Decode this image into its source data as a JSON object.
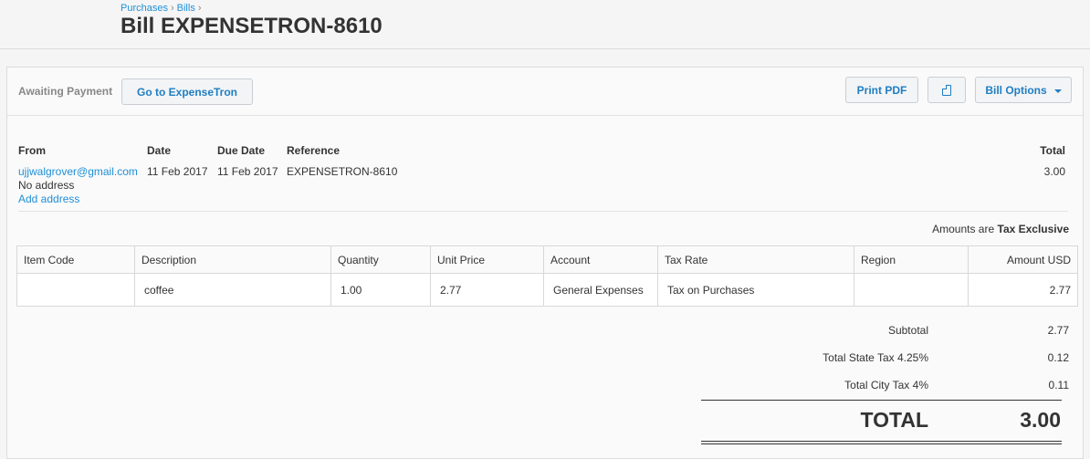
{
  "breadcrumb": [
    "Purchases",
    "Bills"
  ],
  "breadcrumb_sep": "›",
  "title": "Bill EXPENSETRON-8610",
  "toolbar": {
    "status": "Awaiting Payment",
    "goto_label": "Go to ExpenseTron",
    "print_label": "Print PDF",
    "copy_icon": "copy-icon",
    "options_label": "Bill Options"
  },
  "bill": {
    "from_label": "From",
    "from_email": "ujjwalgrover@gmail.com",
    "no_address": "No address",
    "add_address": "Add address",
    "date_label": "Date",
    "date": "11 Feb 2017",
    "due_label": "Due Date",
    "due": "11 Feb 2017",
    "ref_label": "Reference",
    "ref": "EXPENSETRON-8610",
    "total_label": "Total",
    "total": "3.00"
  },
  "amounts": {
    "prefix": "Amounts are",
    "mode": "Tax Exclusive"
  },
  "table": {
    "headers": [
      "Item Code",
      "Description",
      "Quantity",
      "Unit Price",
      "Account",
      "Tax Rate",
      "Region",
      "Amount USD"
    ],
    "rows": [
      [
        "",
        "coffee",
        "1.00",
        "2.77",
        "General Expenses",
        "Tax on Purchases",
        "",
        "2.77"
      ]
    ]
  },
  "totals": {
    "subtotal_label": "Subtotal",
    "subtotal": "2.77",
    "state_label": "Total State Tax 4.25%",
    "state": "0.12",
    "city_label": "Total City Tax 4%",
    "city": "0.11",
    "grand_label": "TOTAL",
    "grand": "3.00"
  },
  "colors": {
    "link": "#1f8fd6",
    "button_text": "#1f7ec2"
  }
}
